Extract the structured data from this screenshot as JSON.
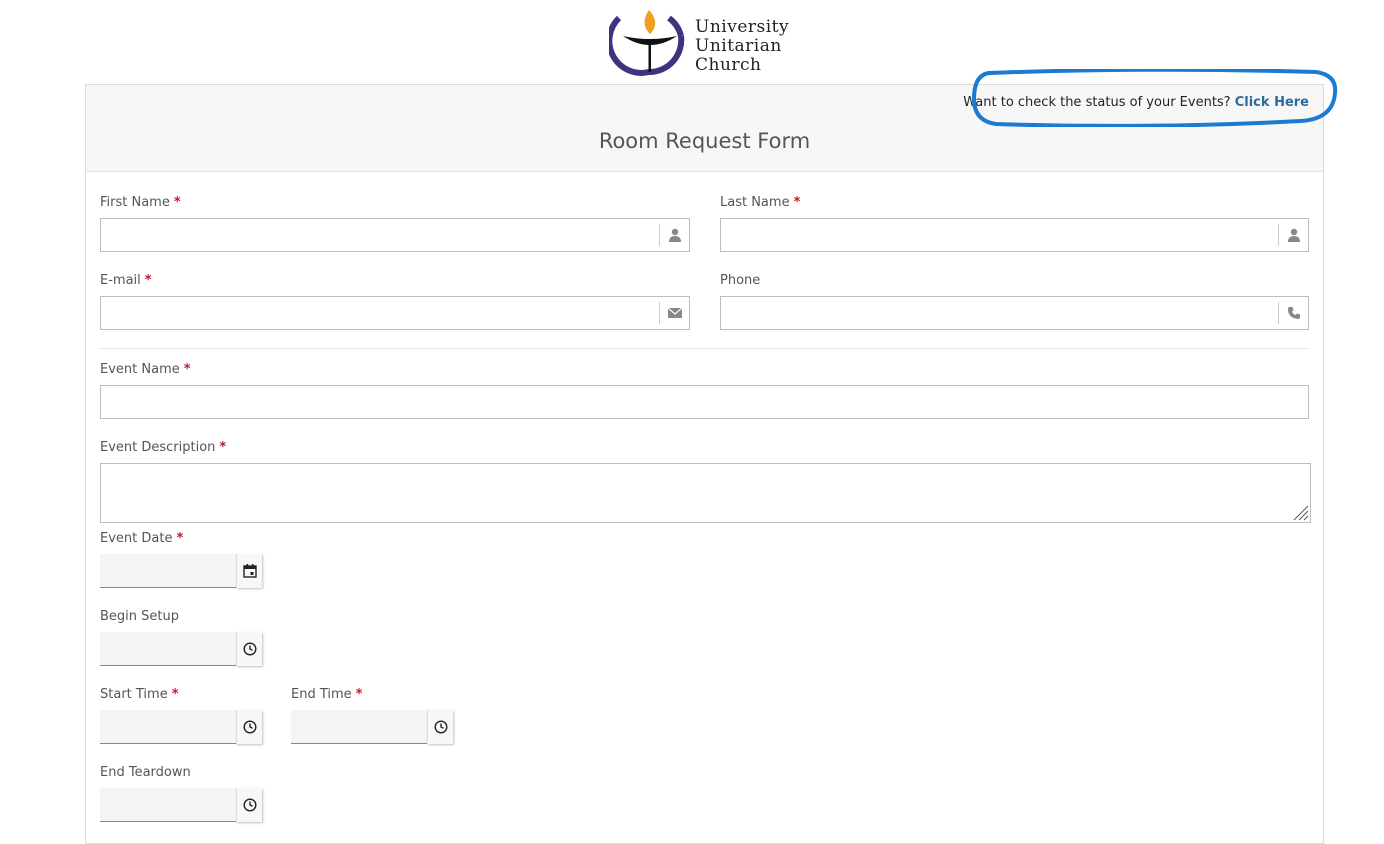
{
  "logo": {
    "line1": "University",
    "line2": "Unitarian",
    "line3": "Church"
  },
  "status": {
    "prompt": "Want to check the status of your Events?",
    "link_label": "Click Here"
  },
  "form": {
    "title": "Room Request Form",
    "required_marker": "*",
    "first_name": {
      "label": "First Name",
      "value": "",
      "icon": "user-icon"
    },
    "last_name": {
      "label": "Last Name",
      "value": "",
      "icon": "user-icon"
    },
    "email": {
      "label": "E-mail",
      "value": "",
      "icon": "envelope-icon"
    },
    "phone": {
      "label": "Phone",
      "value": "",
      "icon": "phone-icon"
    },
    "event_name": {
      "label": "Event Name",
      "value": ""
    },
    "event_description": {
      "label": "Event Description",
      "value": ""
    },
    "event_date": {
      "label": "Event Date",
      "value": "",
      "icon": "calendar-icon"
    },
    "begin_setup": {
      "label": "Begin Setup",
      "value": "",
      "icon": "clock-icon"
    },
    "start_time": {
      "label": "Start Time",
      "value": "",
      "icon": "clock-icon"
    },
    "end_time": {
      "label": "End Time",
      "value": "",
      "icon": "clock-icon"
    },
    "end_teardown": {
      "label": "End Teardown",
      "value": "",
      "icon": "clock-icon"
    }
  },
  "colors": {
    "link": "#2b6c99",
    "required": "#c0182b",
    "highlight": "#1a7ad4",
    "logo_purple": "#3d3480",
    "logo_flame": "#f0a020"
  }
}
